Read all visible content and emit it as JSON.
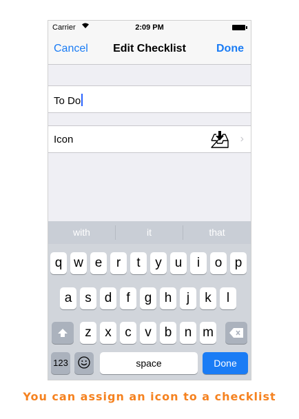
{
  "status_bar": {
    "carrier": "Carrier",
    "time": "2:09 PM"
  },
  "nav": {
    "cancel": "Cancel",
    "title": "Edit Checklist",
    "done": "Done"
  },
  "name_field": {
    "value": "To Do"
  },
  "icon_row": {
    "label": "Icon",
    "icon": "inbox-download-icon",
    "chevron": "›"
  },
  "suggestions": [
    "with",
    "it",
    "that"
  ],
  "keys": {
    "row1": [
      "q",
      "w",
      "e",
      "r",
      "t",
      "y",
      "u",
      "i",
      "o",
      "p"
    ],
    "row2": [
      "a",
      "s",
      "d",
      "f",
      "g",
      "h",
      "j",
      "k",
      "l"
    ],
    "row3": [
      "z",
      "x",
      "c",
      "v",
      "b",
      "n",
      "m"
    ],
    "numbers": "123",
    "space": "space",
    "done": "Done"
  },
  "caption": "You can assign an icon to a checklist",
  "colors": {
    "accent": "#1a7cf5",
    "caption": "#f58220",
    "background": "#efeff4"
  }
}
